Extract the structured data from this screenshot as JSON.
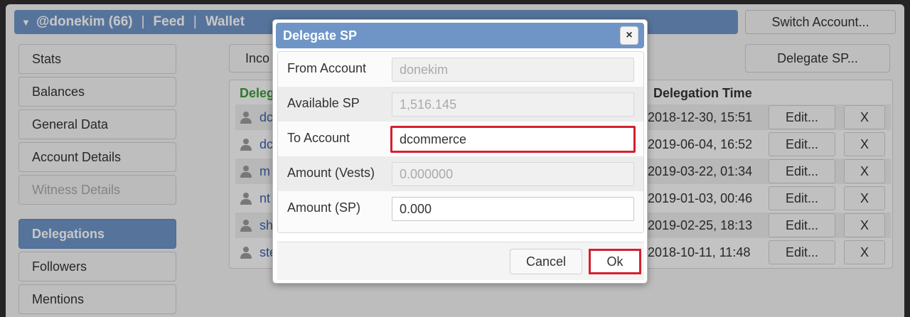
{
  "header": {
    "account": "@donekim (66)",
    "feed": "Feed",
    "wallet": "Wallet",
    "switch_account": "Switch Account..."
  },
  "sidebar": {
    "items": [
      {
        "label": "Stats"
      },
      {
        "label": "Balances"
      },
      {
        "label": "General Data"
      },
      {
        "label": "Account Details"
      },
      {
        "label": "Witness Details"
      },
      {
        "label": "Delegations"
      },
      {
        "label": "Followers"
      },
      {
        "label": "Mentions"
      }
    ]
  },
  "main": {
    "incoming_label": "Inco",
    "delegate_button": "Delegate SP...",
    "col_delegatee": "Delega",
    "col_time": "Delegation Time",
    "rows": [
      {
        "name": "dc",
        "time": "2018-12-30, 15:51",
        "edit": "Edit...",
        "remove": "X"
      },
      {
        "name": "dc",
        "time": "2019-06-04, 16:52",
        "edit": "Edit...",
        "remove": "X"
      },
      {
        "name": "m",
        "time": "2019-03-22, 01:34",
        "edit": "Edit...",
        "remove": "X"
      },
      {
        "name": "nt",
        "time": "2019-01-03, 00:46",
        "edit": "Edit...",
        "remove": "X"
      },
      {
        "name": "sh",
        "time": "2019-02-25, 18:13",
        "edit": "Edit...",
        "remove": "X"
      },
      {
        "name": "ste",
        "time": "2018-10-11, 11:48",
        "edit": "Edit...",
        "remove": "X"
      }
    ]
  },
  "dialog": {
    "title": "Delegate SP",
    "close": "×",
    "fields": {
      "from_account_label": "From Account",
      "from_account_value": "donekim",
      "available_sp_label": "Available SP",
      "available_sp_value": "1,516.145",
      "to_account_label": "To Account",
      "to_account_value": "dcommerce",
      "amount_vests_label": "Amount (Vests)",
      "amount_vests_value": "0.000000",
      "amount_sp_label": "Amount (SP)",
      "amount_sp_value": "0.000"
    },
    "cancel": "Cancel",
    "ok": "Ok"
  },
  "colors": {
    "accent": "#6f95c7",
    "highlight": "#d4202f",
    "green_header": "#3b9b3b",
    "link": "#3b63a8"
  }
}
